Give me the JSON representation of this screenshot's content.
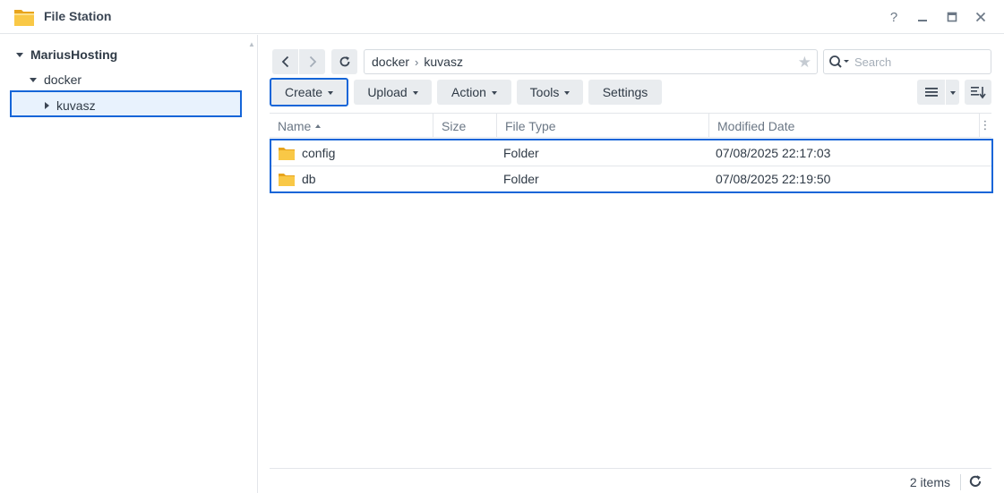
{
  "window": {
    "title": "File Station",
    "help_label": "?"
  },
  "sidebar": {
    "root": {
      "label": "MariusHosting"
    },
    "items": [
      {
        "label": "docker"
      },
      {
        "label": "kuvasz"
      }
    ]
  },
  "pathbar": {
    "segments": [
      "docker",
      "kuvasz"
    ],
    "separator": "›"
  },
  "search": {
    "placeholder": "Search"
  },
  "toolbar": {
    "create_label": "Create",
    "upload_label": "Upload",
    "action_label": "Action",
    "tools_label": "Tools",
    "settings_label": "Settings"
  },
  "table": {
    "columns": [
      "Name",
      "Size",
      "File Type",
      "Modified Date"
    ],
    "rows": [
      {
        "name": "config",
        "size": "",
        "type": "Folder",
        "modified": "07/08/2025 22:17:03"
      },
      {
        "name": "db",
        "size": "",
        "type": "Folder",
        "modified": "07/08/2025 22:19:50"
      }
    ]
  },
  "footer": {
    "item_count": "2 items"
  },
  "colors": {
    "accent": "#1565d8",
    "folder": "#f5c242",
    "button_bg": "#e9ecef"
  },
  "icons": {
    "app": "folder-app-icon",
    "back": "chevron-left-icon",
    "forward": "chevron-right-icon",
    "refresh": "refresh-icon",
    "favorite": "star-icon",
    "search": "search-icon",
    "list_view": "list-view-icon",
    "sort": "sort-icon"
  }
}
